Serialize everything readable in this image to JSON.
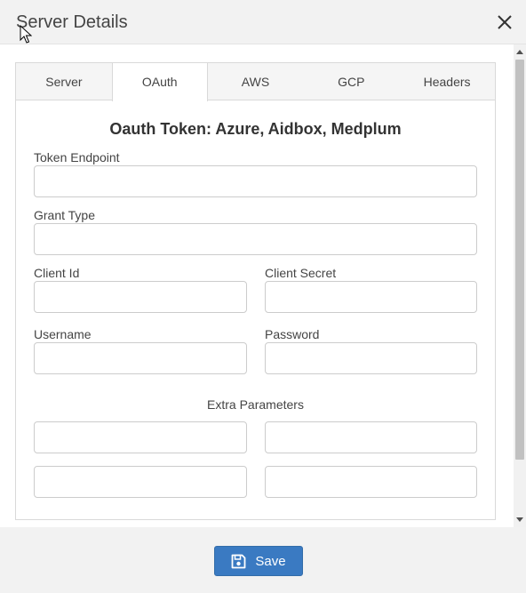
{
  "dialog": {
    "title": "Server Details"
  },
  "tabs": [
    {
      "label": "Server"
    },
    {
      "label": "OAuth"
    },
    {
      "label": "AWS"
    },
    {
      "label": "GCP"
    },
    {
      "label": "Headers"
    }
  ],
  "active_tab": "OAuth",
  "oauth": {
    "heading": "Oauth Token: Azure, Aidbox, Medplum",
    "token_endpoint": {
      "label": "Token Endpoint",
      "value": ""
    },
    "grant_type": {
      "label": "Grant Type",
      "value": ""
    },
    "client_id": {
      "label": "Client Id",
      "value": ""
    },
    "client_secret": {
      "label": "Client Secret",
      "value": ""
    },
    "username": {
      "label": "Username",
      "value": ""
    },
    "password": {
      "label": "Password",
      "value": ""
    },
    "extra_parameters": {
      "label": "Extra Parameters",
      "rows": [
        {
          "key": "",
          "value": ""
        },
        {
          "key": "",
          "value": ""
        }
      ]
    }
  },
  "footer": {
    "save_label": "Save"
  },
  "icons": {
    "close": "close-icon",
    "save": "floppy-disk-icon",
    "cursor": "mouse-pointer-icon"
  },
  "colors": {
    "primary": "#3a7ac2",
    "header_bg": "#f2f2f2"
  }
}
